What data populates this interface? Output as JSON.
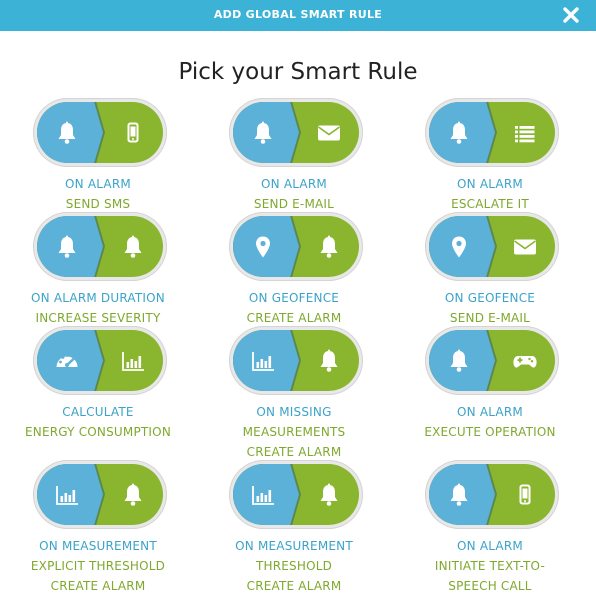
{
  "header": {
    "title": "ADD GLOBAL SMART RULE",
    "close_icon": "close-icon"
  },
  "page_title": "Pick your Smart Rule",
  "colors": {
    "header": "#3cb2d6",
    "left": "#5bb1d8",
    "right": "#8ab52e",
    "label_blue": "#3ba3c9",
    "label_green": "#7fa82d"
  },
  "rules": [
    {
      "id": "alarm-sms",
      "left_icon": "bell",
      "right_icon": "phone",
      "lines": [
        "ON ALARM",
        "SEND SMS"
      ]
    },
    {
      "id": "alarm-email",
      "left_icon": "bell",
      "right_icon": "envelope",
      "lines": [
        "ON ALARM",
        "SEND E-MAIL"
      ]
    },
    {
      "id": "alarm-escalate",
      "left_icon": "bell",
      "right_icon": "list",
      "lines": [
        "ON ALARM",
        "ESCALATE IT"
      ]
    },
    {
      "id": "alarm-duration",
      "left_icon": "bell",
      "right_icon": "bell",
      "lines": [
        "ON ALARM DURATION",
        "INCREASE SEVERITY"
      ]
    },
    {
      "id": "geofence-alarm",
      "left_icon": "pin",
      "right_icon": "bell",
      "lines": [
        "ON GEOFENCE",
        "CREATE ALARM"
      ]
    },
    {
      "id": "geofence-email",
      "left_icon": "pin",
      "right_icon": "envelope",
      "lines": [
        "ON GEOFENCE",
        "SEND E-MAIL"
      ]
    },
    {
      "id": "energy",
      "left_icon": "gauge",
      "right_icon": "chart",
      "lines": [
        "CALCULATE",
        "ENERGY CONSUMPTION"
      ]
    },
    {
      "id": "missing-measurements",
      "left_icon": "chart",
      "right_icon": "bell",
      "lines": [
        "ON MISSING",
        "MEASUREMENTS",
        "CREATE ALARM"
      ]
    },
    {
      "id": "alarm-operation",
      "left_icon": "bell",
      "right_icon": "gamepad",
      "lines": [
        "ON ALARM",
        "EXECUTE OPERATION"
      ]
    },
    {
      "id": "explicit-threshold",
      "left_icon": "chart",
      "right_icon": "bell",
      "lines": [
        "ON MEASUREMENT",
        "EXPLICIT THRESHOLD",
        "CREATE ALARM"
      ]
    },
    {
      "id": "threshold",
      "left_icon": "chart",
      "right_icon": "bell",
      "lines": [
        "ON MEASUREMENT",
        "THRESHOLD",
        "CREATE ALARM"
      ]
    },
    {
      "id": "tts-call",
      "left_icon": "bell",
      "right_icon": "phone",
      "lines": [
        "ON ALARM",
        "INITIATE TEXT-TO-",
        "SPEECH CALL"
      ]
    }
  ]
}
